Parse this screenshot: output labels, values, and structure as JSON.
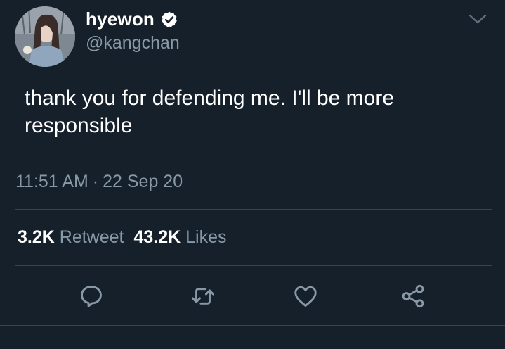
{
  "user": {
    "display_name": "hyewon",
    "handle": "@kangchan",
    "verified_icon": "verified-badge-icon"
  },
  "tweet": {
    "text": "thank you for defending me. I'll be more responsible",
    "time": "11:51 AM",
    "separator": "·",
    "date": "22 Sep 20"
  },
  "stats": {
    "retweets_count": "3.2K",
    "retweets_label": "Retweet",
    "likes_count": "43.2K",
    "likes_label": "Likes"
  },
  "actions": [
    "reply-icon",
    "retweet-icon",
    "like-icon",
    "share-icon"
  ],
  "colors": {
    "background": "#15202b",
    "text_primary": "#ffffff",
    "text_secondary": "#8899a6",
    "divider": "#38444d"
  }
}
